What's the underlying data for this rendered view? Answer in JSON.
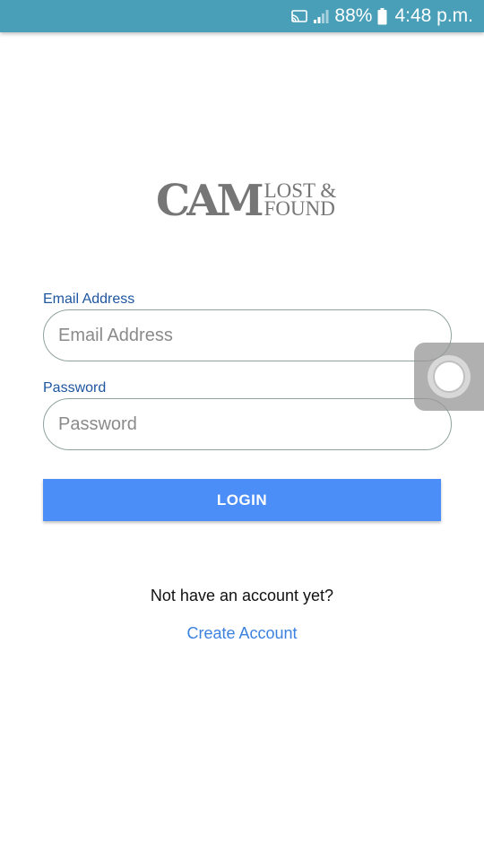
{
  "status_bar": {
    "battery_percent": "88%",
    "time": "4:48 p.m.",
    "icons": [
      "cast-icon",
      "signal-icon",
      "battery-icon"
    ]
  },
  "logo": {
    "main": "CAM",
    "line1": "LOST &",
    "line2": "FOUND"
  },
  "form": {
    "email": {
      "label": "Email Address",
      "placeholder": "Email Address",
      "value": ""
    },
    "password": {
      "label": "Password",
      "placeholder": "Password",
      "value": ""
    },
    "login_label": "LOGIN"
  },
  "signup": {
    "prompt": "Not have an account yet?",
    "link": "Create Account"
  },
  "colors": {
    "status_bar": "#4a9fb8",
    "label_blue": "#1e56a0",
    "button_blue": "#4b8ef7",
    "link_blue": "#3b82e0",
    "logo_gray": "#767676"
  }
}
